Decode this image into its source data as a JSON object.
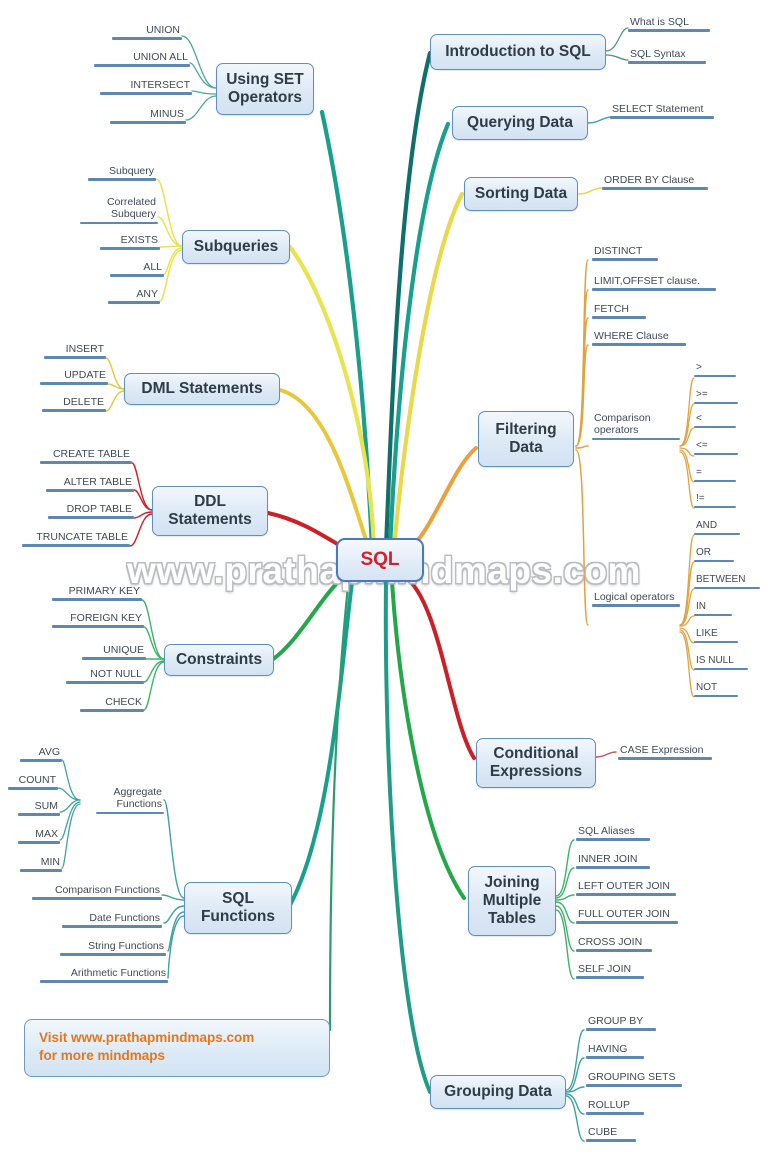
{
  "map": {
    "title": "SQL",
    "watermark": "www.prathapmindmaps.com",
    "colors": {
      "node_border": "#5f8fbf",
      "node_fill": "#dde9f5",
      "central_text": "#d4202a",
      "leaf_underline": "#5e87b3",
      "promo_text": "#e07820",
      "branch_teal": "#17a08c",
      "branch_darkteal": "#0f7a8f",
      "branch_yellow": "#e8d020",
      "branch_orange": "#e9a23b",
      "branch_red": "#cc2027",
      "branch_green": "#22a84a",
      "branch_blue": "#1f7ea8"
    }
  },
  "promo": {
    "line1": "Visit www.prathapmindmaps.com",
    "line2": "for more mindmaps"
  },
  "branches": [
    {
      "id": "using-set-operators",
      "label": "Using SET Operators",
      "side": "left",
      "color": "#17a08c",
      "children": [
        {
          "label": "UNION"
        },
        {
          "label": "UNION ALL"
        },
        {
          "label": "INTERSECT"
        },
        {
          "label": "MINUS"
        }
      ]
    },
    {
      "id": "subqueries",
      "label": "Subqueries",
      "side": "left",
      "color": "#e8e44f",
      "children": [
        {
          "label": "Subquery"
        },
        {
          "label": "Correlated Subquery"
        },
        {
          "label": "EXISTS"
        },
        {
          "label": "ALL"
        },
        {
          "label": "ANY"
        }
      ]
    },
    {
      "id": "dml-statements",
      "label": "DML Statements",
      "side": "left",
      "color": "#e8c83a",
      "children": [
        {
          "label": "INSERT"
        },
        {
          "label": "UPDATE"
        },
        {
          "label": "DELETE"
        }
      ]
    },
    {
      "id": "ddl-statements",
      "label": "DDL Statements",
      "side": "left",
      "color": "#cc2027",
      "children": [
        {
          "label": "CREATE TABLE"
        },
        {
          "label": "ALTER TABLE"
        },
        {
          "label": "DROP TABLE"
        },
        {
          "label": "TRUNCATE TABLE"
        }
      ]
    },
    {
      "id": "constraints",
      "label": "Constraints",
      "side": "left",
      "color": "#22a84a",
      "children": [
        {
          "label": "PRIMARY KEY"
        },
        {
          "label": "FOREIGN KEY"
        },
        {
          "label": "UNIQUE"
        },
        {
          "label": "NOT NULL"
        },
        {
          "label": "CHECK"
        }
      ]
    },
    {
      "id": "sql-functions",
      "label": "SQL Functions",
      "side": "left",
      "color": "#17a08c",
      "children": [
        {
          "label": "Aggregate Functions",
          "children": [
            {
              "label": "AVG"
            },
            {
              "label": "COUNT"
            },
            {
              "label": "SUM"
            },
            {
              "label": "MAX"
            },
            {
              "label": "MIN"
            }
          ]
        },
        {
          "label": "Comparison Functions"
        },
        {
          "label": "Date Functions"
        },
        {
          "label": "String Functions"
        },
        {
          "label": "Arithmetic Functions"
        }
      ]
    },
    {
      "id": "introduction-to-sql",
      "label": "Introduction to SQL",
      "side": "right",
      "color": "#0f6f6a",
      "children": [
        {
          "label": "What is SQL"
        },
        {
          "label": "SQL Syntax"
        }
      ]
    },
    {
      "id": "querying-data",
      "label": "Querying Data",
      "side": "right",
      "color": "#17a08c",
      "children": [
        {
          "label": "SELECT Statement"
        }
      ]
    },
    {
      "id": "sorting-data",
      "label": "Sorting Data",
      "side": "right",
      "color": "#e8d84a",
      "children": [
        {
          "label": "ORDER BY Clause"
        }
      ]
    },
    {
      "id": "filtering-data",
      "label": "Filtering Data",
      "side": "right",
      "color": "#e9a23b",
      "children": [
        {
          "label": "DISTINCT"
        },
        {
          "label": "LIMIT,OFFSET clause."
        },
        {
          "label": "FETCH"
        },
        {
          "label": "WHERE Clause"
        },
        {
          "label": "Comparison operators",
          "children": [
            {
              "label": ">"
            },
            {
              "label": ">="
            },
            {
              "label": "<"
            },
            {
              "label": "<="
            },
            {
              "label": "="
            },
            {
              "label": "!="
            }
          ]
        },
        {
          "label": "Logical operators",
          "children": [
            {
              "label": "AND"
            },
            {
              "label": "OR"
            },
            {
              "label": "BETWEEN"
            },
            {
              "label": "IN"
            },
            {
              "label": "LIKE"
            },
            {
              "label": "IS NULL"
            },
            {
              "label": "NOT"
            }
          ]
        }
      ]
    },
    {
      "id": "conditional-expressions",
      "label": "Conditional Expressions",
      "side": "right",
      "color": "#cc2027",
      "children": [
        {
          "label": "CASE Expression"
        }
      ]
    },
    {
      "id": "joining-multiple-tables",
      "label": "Joining Multiple Tables",
      "side": "right",
      "color": "#22a84a",
      "children": [
        {
          "label": "SQL Aliases"
        },
        {
          "label": "INNER JOIN"
        },
        {
          "label": "LEFT OUTER JOIN"
        },
        {
          "label": "FULL OUTER JOIN"
        },
        {
          "label": "CROSS JOIN"
        },
        {
          "label": "SELF JOIN"
        }
      ]
    },
    {
      "id": "grouping-data",
      "label": "Grouping Data",
      "side": "right",
      "color": "#1f9c86",
      "children": [
        {
          "label": "GROUP BY"
        },
        {
          "label": "HAVING"
        },
        {
          "label": "GROUPING SETS"
        },
        {
          "label": "ROLLUP"
        },
        {
          "label": "CUBE"
        }
      ]
    }
  ]
}
